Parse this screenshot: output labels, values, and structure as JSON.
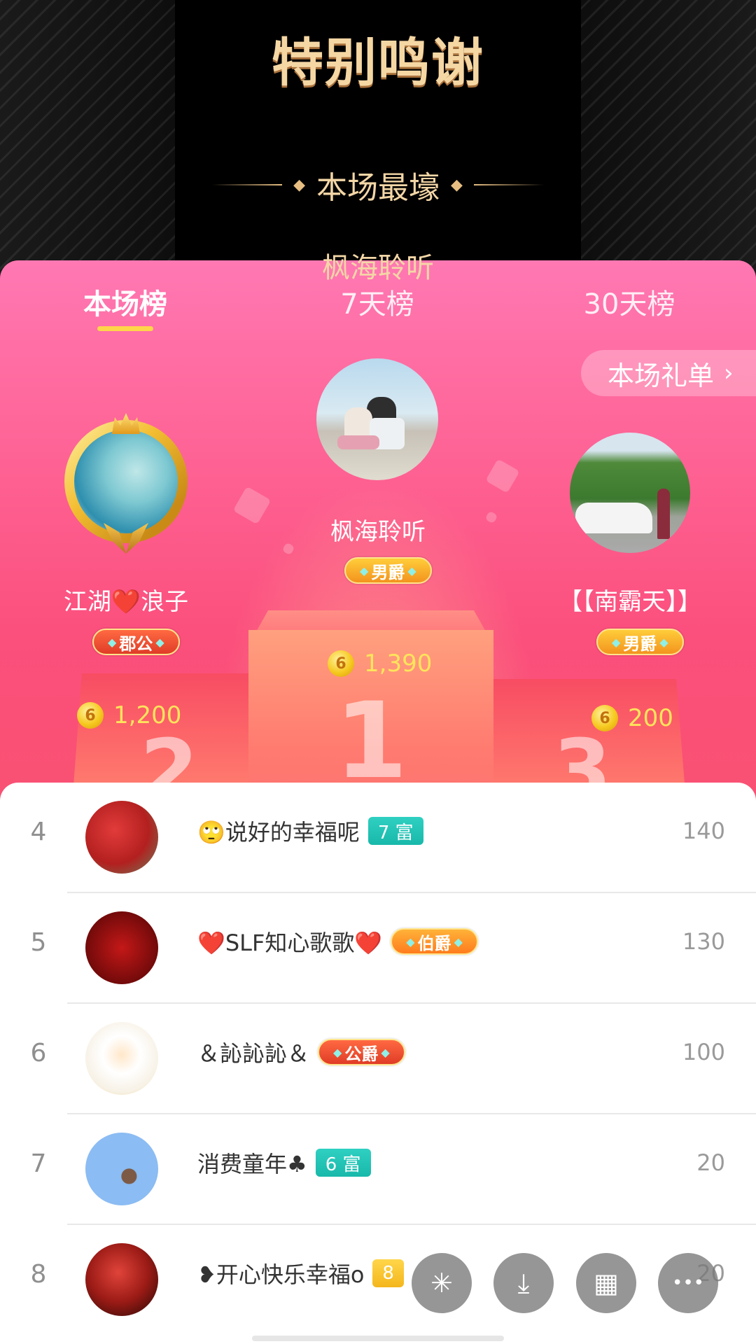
{
  "banner": {
    "title": "特别鸣谢",
    "subtitle": "本场最壕",
    "peek_name": "枫海聆听"
  },
  "tabs": [
    {
      "label": "本场榜",
      "active": true
    },
    {
      "label": "7天榜",
      "active": false
    },
    {
      "label": "30天榜",
      "active": false
    }
  ],
  "gift_list_button": {
    "label": "本场礼单",
    "chevron": "›"
  },
  "podium": {
    "first": {
      "name": "枫海聆听",
      "badge": "男爵",
      "score": "1,390",
      "place": "1"
    },
    "second": {
      "name": "江湖❤️浪子",
      "badge": "郡公",
      "score": "1,200",
      "place": "2"
    },
    "third": {
      "name": "【【南霸天】】",
      "badge": "男爵",
      "score": "200",
      "place": "3"
    }
  },
  "coin_glyph": "6",
  "list": [
    {
      "rank": "4",
      "name": "🙄说好的幸福呢",
      "badge": "7 富",
      "badge_style": "teal",
      "value": "140"
    },
    {
      "rank": "5",
      "name": "❤️SLF知心歌歌❤️",
      "badge": "伯爵",
      "badge_style": "orange",
      "value": "130"
    },
    {
      "rank": "6",
      "name": "＆訫訫訫＆",
      "badge": "公爵",
      "badge_style": "red",
      "value": "100"
    },
    {
      "rank": "7",
      "name": "消费童年♣",
      "badge": "6 富",
      "badge_style": "teal",
      "value": "20"
    },
    {
      "rank": "8",
      "name": "❥开心快乐幸福o",
      "badge": "8",
      "badge_style": "yellow",
      "value": "20"
    }
  ],
  "fabs": [
    {
      "icon": "sparkle-icon",
      "glyph": "✳"
    },
    {
      "icon": "download-icon",
      "glyph": "⤓"
    },
    {
      "icon": "grid-icon",
      "glyph": "▦"
    },
    {
      "icon": "more-icon",
      "glyph": "•••"
    }
  ],
  "colors": {
    "panel_pink": "#fb4f7c",
    "tab_underline": "#ffd54a",
    "score_yellow": "#ffe45b",
    "rich_teal": "#18b8aa"
  }
}
